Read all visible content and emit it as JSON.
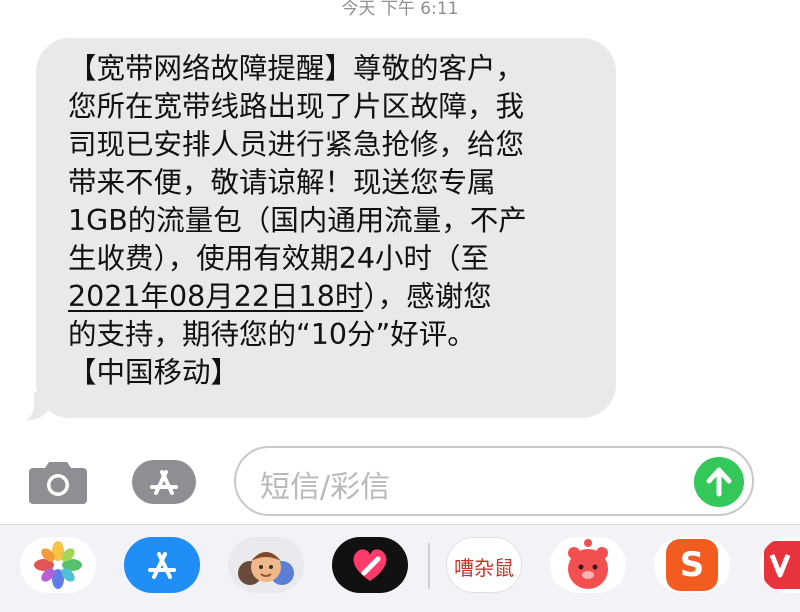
{
  "status": {
    "timestamp": "今天 下午 6:11"
  },
  "message": {
    "lines": [
      "【宽带网络故障提醒】尊敬的客户，",
      "您所在宽带线路出现了片区故障，我",
      "司现已安排人员进行紧急抢修，给您",
      "带来不便，敬请谅解！现送您专属",
      "1GB的流量包（国内通用流量，不产",
      "生收费），使用有效期24小时（至",
      "2021年08月22日18时），感谢您",
      "的支持，期待您的“10分”好评。",
      "【中国移动】"
    ],
    "underlined_part": "2021年08月22日18时",
    "after_underline": "），感谢您"
  },
  "composer": {
    "placeholder": "短信/彩信",
    "camera_icon": "camera-icon",
    "apps_icon": "app-store-icon",
    "send_icon": "arrow-up-icon"
  },
  "app_drawer": {
    "apps": [
      {
        "name": "photos-app",
        "icon": "photos-icon"
      },
      {
        "name": "app-store-app",
        "icon": "app-store-icon"
      },
      {
        "name": "memoji-app",
        "icon": "memoji-icon"
      },
      {
        "name": "digital-touch-app",
        "icon": "heart-icon"
      },
      {
        "name": "sticker-app",
        "icon": "sticker-icon",
        "text": "嘈杂鼠"
      },
      {
        "name": "pig-sticker-app",
        "icon": "pig-icon"
      },
      {
        "name": "sogou-app",
        "icon": "sogou-icon",
        "text": "S"
      },
      {
        "name": "partial-app",
        "icon": "app-icon"
      }
    ]
  },
  "colors": {
    "bubble": "#e9e9eb",
    "send": "#34c759",
    "placeholder": "#b9b9bd"
  }
}
